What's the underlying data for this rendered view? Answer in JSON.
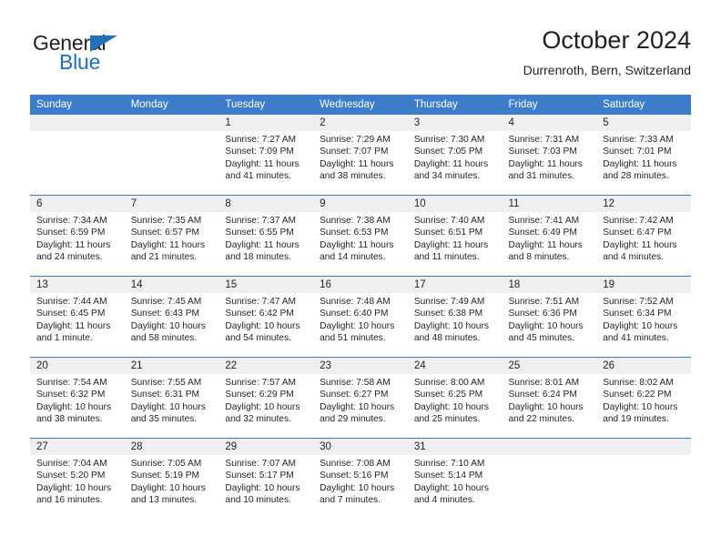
{
  "brand": {
    "name_part1": "General",
    "name_part2": "Blue",
    "accent_color": "#1f71b8"
  },
  "header": {
    "title": "October 2024",
    "subtitle": "Durrenroth, Bern, Switzerland",
    "header_band_color": "#3d7cc9",
    "daynum_band_color": "#efefef"
  },
  "weekdays": [
    "Sunday",
    "Monday",
    "Tuesday",
    "Wednesday",
    "Thursday",
    "Friday",
    "Saturday"
  ],
  "labels": {
    "sunrise_prefix": "Sunrise:",
    "sunset_prefix": "Sunset:",
    "daylight_prefix": "Daylight:"
  },
  "weeks": [
    [
      {
        "day": ""
      },
      {
        "day": ""
      },
      {
        "day": "1",
        "sunrise": "Sunrise: 7:27 AM",
        "sunset": "Sunset: 7:09 PM",
        "daylight_l1": "Daylight: 11 hours",
        "daylight_l2": "and 41 minutes."
      },
      {
        "day": "2",
        "sunrise": "Sunrise: 7:29 AM",
        "sunset": "Sunset: 7:07 PM",
        "daylight_l1": "Daylight: 11 hours",
        "daylight_l2": "and 38 minutes."
      },
      {
        "day": "3",
        "sunrise": "Sunrise: 7:30 AM",
        "sunset": "Sunset: 7:05 PM",
        "daylight_l1": "Daylight: 11 hours",
        "daylight_l2": "and 34 minutes."
      },
      {
        "day": "4",
        "sunrise": "Sunrise: 7:31 AM",
        "sunset": "Sunset: 7:03 PM",
        "daylight_l1": "Daylight: 11 hours",
        "daylight_l2": "and 31 minutes."
      },
      {
        "day": "5",
        "sunrise": "Sunrise: 7:33 AM",
        "sunset": "Sunset: 7:01 PM",
        "daylight_l1": "Daylight: 11 hours",
        "daylight_l2": "and 28 minutes."
      }
    ],
    [
      {
        "day": "6",
        "sunrise": "Sunrise: 7:34 AM",
        "sunset": "Sunset: 6:59 PM",
        "daylight_l1": "Daylight: 11 hours",
        "daylight_l2": "and 24 minutes."
      },
      {
        "day": "7",
        "sunrise": "Sunrise: 7:35 AM",
        "sunset": "Sunset: 6:57 PM",
        "daylight_l1": "Daylight: 11 hours",
        "daylight_l2": "and 21 minutes."
      },
      {
        "day": "8",
        "sunrise": "Sunrise: 7:37 AM",
        "sunset": "Sunset: 6:55 PM",
        "daylight_l1": "Daylight: 11 hours",
        "daylight_l2": "and 18 minutes."
      },
      {
        "day": "9",
        "sunrise": "Sunrise: 7:38 AM",
        "sunset": "Sunset: 6:53 PM",
        "daylight_l1": "Daylight: 11 hours",
        "daylight_l2": "and 14 minutes."
      },
      {
        "day": "10",
        "sunrise": "Sunrise: 7:40 AM",
        "sunset": "Sunset: 6:51 PM",
        "daylight_l1": "Daylight: 11 hours",
        "daylight_l2": "and 11 minutes."
      },
      {
        "day": "11",
        "sunrise": "Sunrise: 7:41 AM",
        "sunset": "Sunset: 6:49 PM",
        "daylight_l1": "Daylight: 11 hours",
        "daylight_l2": "and 8 minutes."
      },
      {
        "day": "12",
        "sunrise": "Sunrise: 7:42 AM",
        "sunset": "Sunset: 6:47 PM",
        "daylight_l1": "Daylight: 11 hours",
        "daylight_l2": "and 4 minutes."
      }
    ],
    [
      {
        "day": "13",
        "sunrise": "Sunrise: 7:44 AM",
        "sunset": "Sunset: 6:45 PM",
        "daylight_l1": "Daylight: 11 hours",
        "daylight_l2": "and 1 minute."
      },
      {
        "day": "14",
        "sunrise": "Sunrise: 7:45 AM",
        "sunset": "Sunset: 6:43 PM",
        "daylight_l1": "Daylight: 10 hours",
        "daylight_l2": "and 58 minutes."
      },
      {
        "day": "15",
        "sunrise": "Sunrise: 7:47 AM",
        "sunset": "Sunset: 6:42 PM",
        "daylight_l1": "Daylight: 10 hours",
        "daylight_l2": "and 54 minutes."
      },
      {
        "day": "16",
        "sunrise": "Sunrise: 7:48 AM",
        "sunset": "Sunset: 6:40 PM",
        "daylight_l1": "Daylight: 10 hours",
        "daylight_l2": "and 51 minutes."
      },
      {
        "day": "17",
        "sunrise": "Sunrise: 7:49 AM",
        "sunset": "Sunset: 6:38 PM",
        "daylight_l1": "Daylight: 10 hours",
        "daylight_l2": "and 48 minutes."
      },
      {
        "day": "18",
        "sunrise": "Sunrise: 7:51 AM",
        "sunset": "Sunset: 6:36 PM",
        "daylight_l1": "Daylight: 10 hours",
        "daylight_l2": "and 45 minutes."
      },
      {
        "day": "19",
        "sunrise": "Sunrise: 7:52 AM",
        "sunset": "Sunset: 6:34 PM",
        "daylight_l1": "Daylight: 10 hours",
        "daylight_l2": "and 41 minutes."
      }
    ],
    [
      {
        "day": "20",
        "sunrise": "Sunrise: 7:54 AM",
        "sunset": "Sunset: 6:32 PM",
        "daylight_l1": "Daylight: 10 hours",
        "daylight_l2": "and 38 minutes."
      },
      {
        "day": "21",
        "sunrise": "Sunrise: 7:55 AM",
        "sunset": "Sunset: 6:31 PM",
        "daylight_l1": "Daylight: 10 hours",
        "daylight_l2": "and 35 minutes."
      },
      {
        "day": "22",
        "sunrise": "Sunrise: 7:57 AM",
        "sunset": "Sunset: 6:29 PM",
        "daylight_l1": "Daylight: 10 hours",
        "daylight_l2": "and 32 minutes."
      },
      {
        "day": "23",
        "sunrise": "Sunrise: 7:58 AM",
        "sunset": "Sunset: 6:27 PM",
        "daylight_l1": "Daylight: 10 hours",
        "daylight_l2": "and 29 minutes."
      },
      {
        "day": "24",
        "sunrise": "Sunrise: 8:00 AM",
        "sunset": "Sunset: 6:25 PM",
        "daylight_l1": "Daylight: 10 hours",
        "daylight_l2": "and 25 minutes."
      },
      {
        "day": "25",
        "sunrise": "Sunrise: 8:01 AM",
        "sunset": "Sunset: 6:24 PM",
        "daylight_l1": "Daylight: 10 hours",
        "daylight_l2": "and 22 minutes."
      },
      {
        "day": "26",
        "sunrise": "Sunrise: 8:02 AM",
        "sunset": "Sunset: 6:22 PM",
        "daylight_l1": "Daylight: 10 hours",
        "daylight_l2": "and 19 minutes."
      }
    ],
    [
      {
        "day": "27",
        "sunrise": "Sunrise: 7:04 AM",
        "sunset": "Sunset: 5:20 PM",
        "daylight_l1": "Daylight: 10 hours",
        "daylight_l2": "and 16 minutes."
      },
      {
        "day": "28",
        "sunrise": "Sunrise: 7:05 AM",
        "sunset": "Sunset: 5:19 PM",
        "daylight_l1": "Daylight: 10 hours",
        "daylight_l2": "and 13 minutes."
      },
      {
        "day": "29",
        "sunrise": "Sunrise: 7:07 AM",
        "sunset": "Sunset: 5:17 PM",
        "daylight_l1": "Daylight: 10 hours",
        "daylight_l2": "and 10 minutes."
      },
      {
        "day": "30",
        "sunrise": "Sunrise: 7:08 AM",
        "sunset": "Sunset: 5:16 PM",
        "daylight_l1": "Daylight: 10 hours",
        "daylight_l2": "and 7 minutes."
      },
      {
        "day": "31",
        "sunrise": "Sunrise: 7:10 AM",
        "sunset": "Sunset: 5:14 PM",
        "daylight_l1": "Daylight: 10 hours",
        "daylight_l2": "and 4 minutes."
      },
      {
        "day": ""
      },
      {
        "day": ""
      }
    ]
  ]
}
